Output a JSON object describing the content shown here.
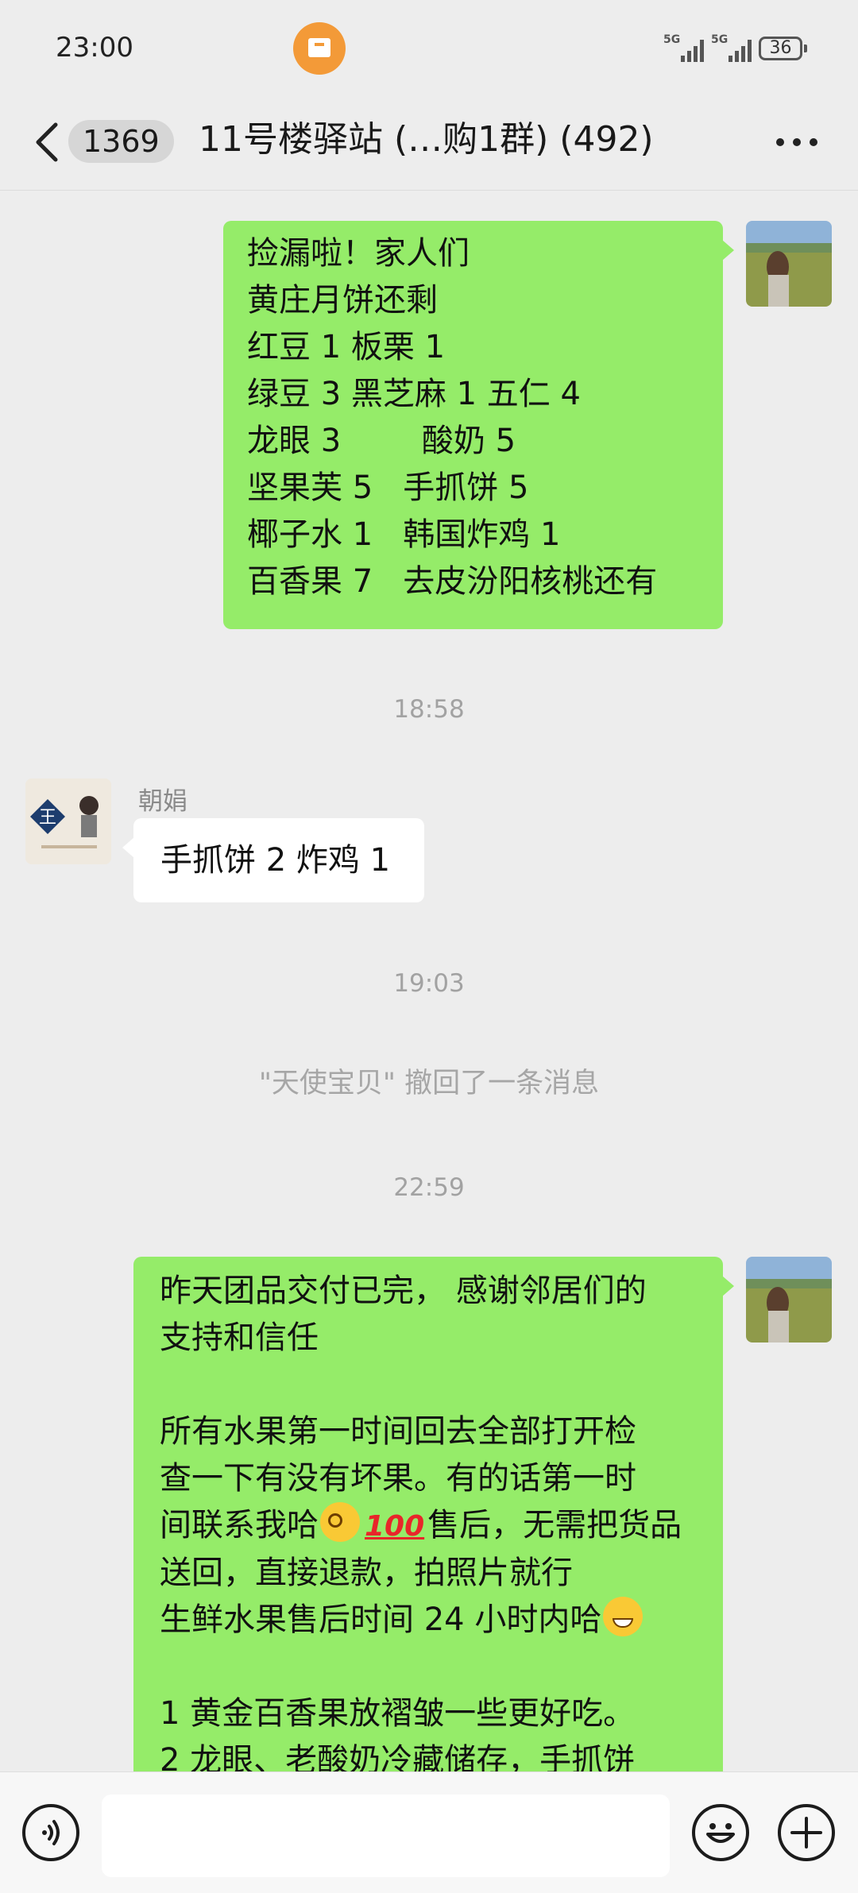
{
  "status_bar": {
    "time": "23:00",
    "network_1": "5G",
    "network_2": "5G",
    "battery": "36"
  },
  "header": {
    "unread_count": "1369",
    "title": "11号楼驿站 (…购1群) (492)"
  },
  "messages": {
    "m1": {
      "lines": [
        "捡漏啦！家人们",
        "黄庄月饼还剩",
        "红豆 1 板栗 1",
        "绿豆 3 黑芝麻 1 五仁 4",
        "龙眼 3        酸奶 5",
        "坚果芙 5   手抓饼 5",
        "椰子水 1   韩国炸鸡 1",
        "百香果 7   去皮汾阳核桃还有"
      ]
    },
    "ts1": "18:58",
    "m2": {
      "sender": "朝娟",
      "text": "手抓饼 2 炸鸡 1"
    },
    "ts2": "19:03",
    "recall_notice": "\"天使宝贝\" 撤回了一条消息",
    "ts3": "22:59",
    "m3": {
      "line1": "昨天团品交付已完， 感谢邻居们的",
      "line2": "支持和信任",
      "line3": "所有水果第一时间回去全部打开检",
      "line4": "查一下有没有坏果。有的话第一时",
      "line5_a": "间联系我哈",
      "line5_b": "售后，无需把货品",
      "line6": "送回，直接退款，拍照片就行",
      "line7": "生鲜水果售后时间 24 小时内哈",
      "line8": "1 黄金百香果放褶皱一些更好吃。",
      "line9": "2 龙眼、老酸奶冷藏储存，手抓饼"
    }
  },
  "icons": {
    "voice": "voice-icon",
    "emoji": "emoji-icon",
    "plus": "plus-icon"
  },
  "colors": {
    "sent_bubble": "#95ec69",
    "received_bubble": "#ffffff",
    "background": "#ededed"
  }
}
